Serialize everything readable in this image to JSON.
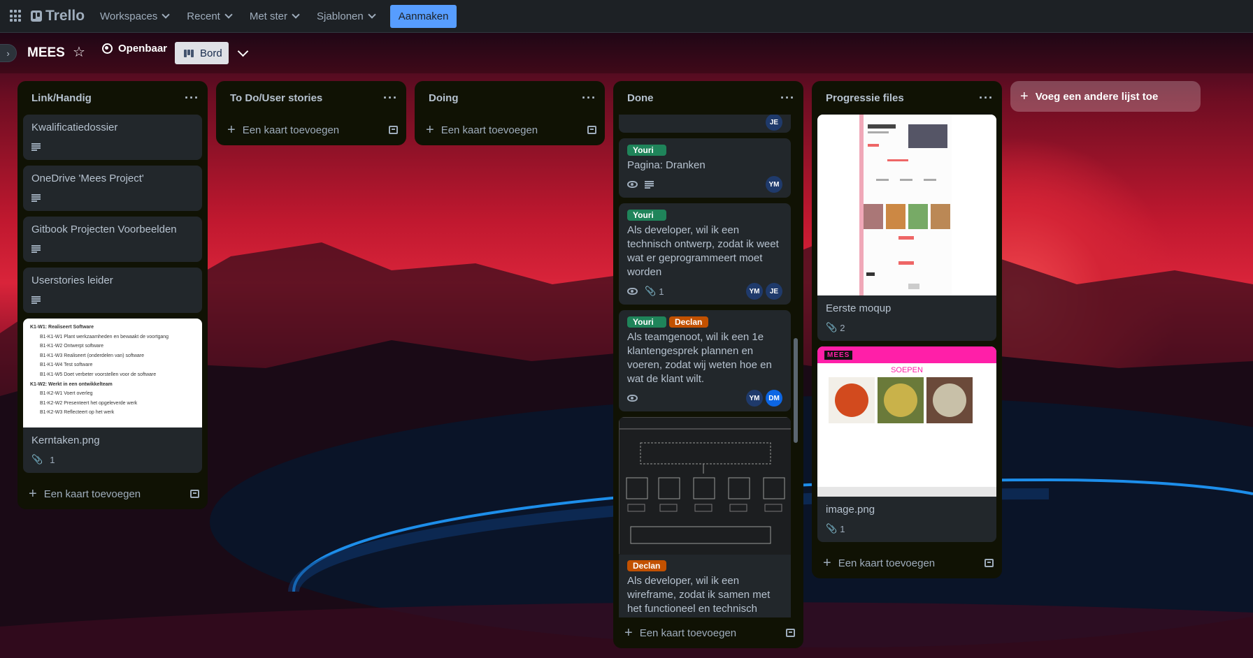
{
  "topbar": {
    "logo": "Trello",
    "nav": [
      {
        "label": "Workspaces"
      },
      {
        "label": "Recent"
      },
      {
        "label": "Met ster"
      },
      {
        "label": "Sjablonen"
      }
    ],
    "create_label": "Aanmaken"
  },
  "board": {
    "title": "MEES",
    "visibility": "Openbaar",
    "view": "Bord"
  },
  "lists": [
    {
      "title": "Link/Handig",
      "cards": [
        {
          "title": "Kwalificatiedossier"
        },
        {
          "title": "OneDrive 'Mees Project'"
        },
        {
          "title": "Gitbook Projecten Voorbeelden"
        },
        {
          "title": "Userstories leider"
        },
        {
          "title": "Kerntaken.png",
          "attachments": "1",
          "cover_lines": [
            "K1-W1: Realiseert Software",
            "B1-K1-W1 Plant werkzaamheden en bewaakt de voortgang",
            "B1-K1-W2 Ontwerpt software",
            "B1-K1-W3 Realiseert (onderdelen van) software",
            "B1-K1-W4 Test software",
            "B1-K1-W5 Doet verbeter voorstellen voor de software",
            "K1-W2: Werkt in een ontwikkelteam",
            "B1-K2-W1 Voert overleg",
            "B1-K2-W2 Presenteert het opgeleverde werk",
            "B1-K2-W3 Reflecteert op het werk"
          ]
        }
      ],
      "add_card": "Een kaart toevoegen"
    },
    {
      "title": "To Do/User stories",
      "add_card": "Een kaart toevoegen"
    },
    {
      "title": "Doing",
      "add_card": "Een kaart toevoegen"
    },
    {
      "title": "Done",
      "cards": [
        {
          "members": [
            "JE"
          ]
        },
        {
          "labels": [
            "Youri"
          ],
          "title": "Pagina: Dranken",
          "members": [
            "YM"
          ]
        },
        {
          "labels": [
            "Youri"
          ],
          "title": "Als developer, wil ik een technisch ontwerp, zodat ik weet wat er geprogrammeert moet worden",
          "attachments": "1",
          "members": [
            "YM",
            "JE"
          ]
        },
        {
          "labels": [
            "Youri",
            "Declan"
          ],
          "title": "Als teamgenoot, wil ik een 1e klantengesprek plannen en voeren, zodat wij weten hoe en wat de klant wilt.",
          "members": [
            "YM",
            "DM"
          ]
        },
        {
          "labels": [
            "Declan"
          ],
          "title": "Als developer, wil ik een wireframe, zodat ik samen met het functioneel en technisch ontwerp precies weet hoe ik verder moet in mijn project"
        }
      ],
      "add_card": "Een kaart toevoegen"
    },
    {
      "title": "Progressie files",
      "cards": [
        {
          "title": "Eerste moqup",
          "attachments": "2"
        },
        {
          "title": "image.png",
          "attachments": "1",
          "cover_logo": "MEES",
          "cover_heading": "SOEPEN"
        }
      ],
      "add_card": "Een kaart toevoegen"
    }
  ],
  "add_list": "Voeg een andere lijst toe",
  "colors": {
    "topbar": "#1d2125",
    "list_bg": "#101204",
    "card_bg": "#22272b",
    "accent": "#579dff",
    "label_green": "#1f845a",
    "label_orange": "#c25100"
  }
}
